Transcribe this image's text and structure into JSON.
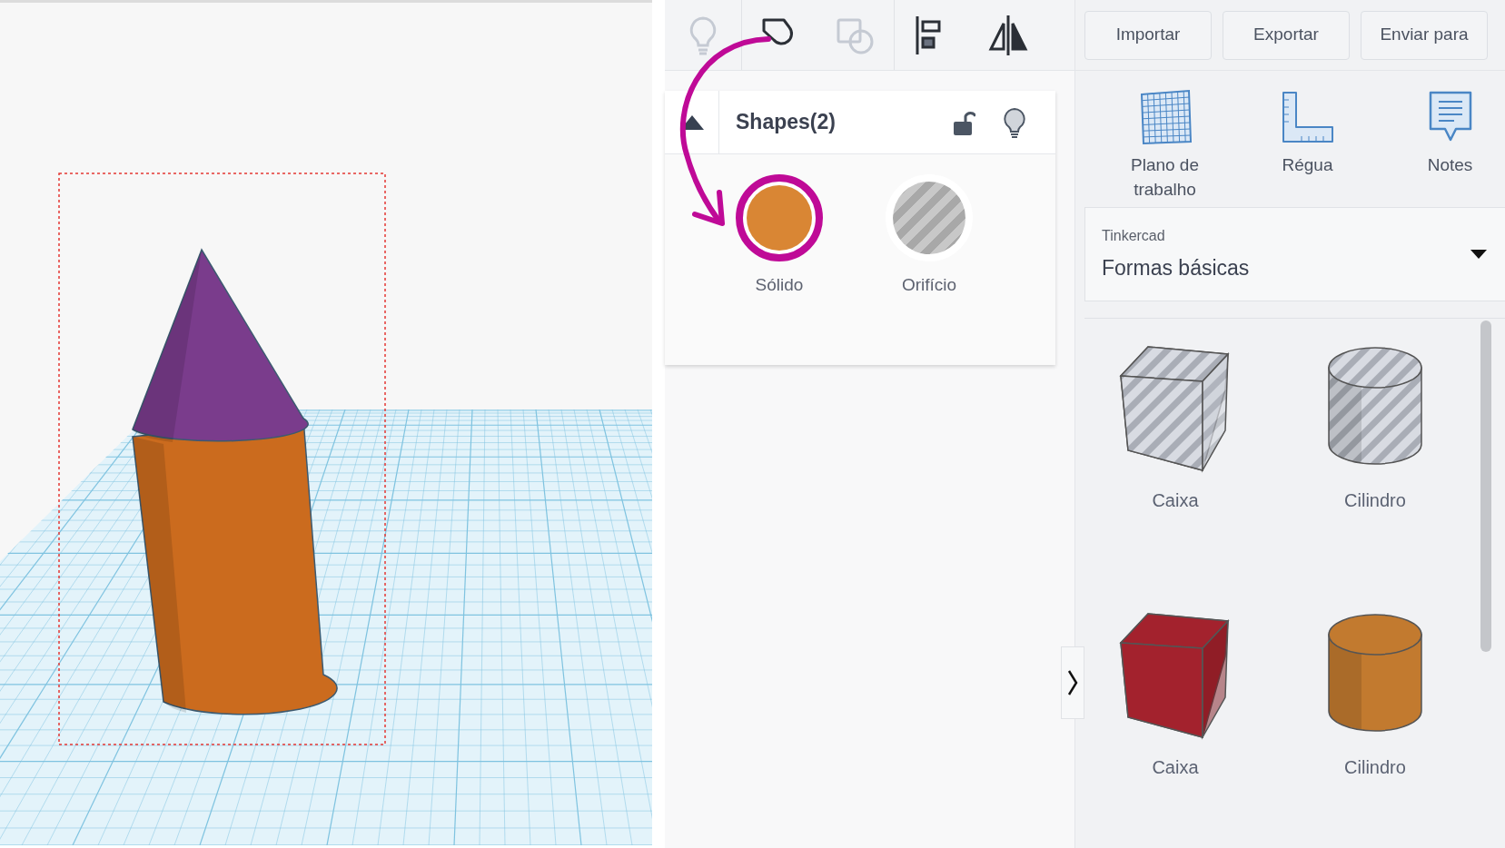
{
  "toolbar": {
    "tools": [
      {
        "kind": "bulb",
        "disabled": true
      },
      {
        "kind": "shape",
        "disabled": false
      },
      {
        "kind": "duplicate",
        "disabled": true
      },
      {
        "kind": "align",
        "disabled": false
      },
      {
        "kind": "mirror",
        "disabled": false
      }
    ],
    "buttons": [
      "Importar",
      "Exportar",
      "Enviar para"
    ]
  },
  "inspector": {
    "title": "Shapes(2)",
    "locked": false,
    "options": [
      {
        "label": "Sólido",
        "kind": "solid",
        "selected": true
      },
      {
        "label": "Orifício",
        "kind": "hole",
        "selected": false
      }
    ]
  },
  "panel_tools": [
    {
      "label": "Plano de trabalho",
      "kind": "workplane"
    },
    {
      "label": "Régua",
      "kind": "ruler"
    },
    {
      "label": "Notes",
      "kind": "notes"
    }
  ],
  "library": {
    "source": "Tinkercad",
    "category": "Formas básicas"
  },
  "shapes": [
    {
      "label": "Caixa",
      "kind": "box",
      "hole": true
    },
    {
      "label": "Cilindro",
      "kind": "cylinder",
      "hole": true
    },
    {
      "label": "Caixa",
      "kind": "box",
      "hole": false,
      "color": "#a3222d"
    },
    {
      "label": "Cilindro",
      "kind": "cylinder",
      "hole": false,
      "color": "#c27a2f"
    }
  ]
}
